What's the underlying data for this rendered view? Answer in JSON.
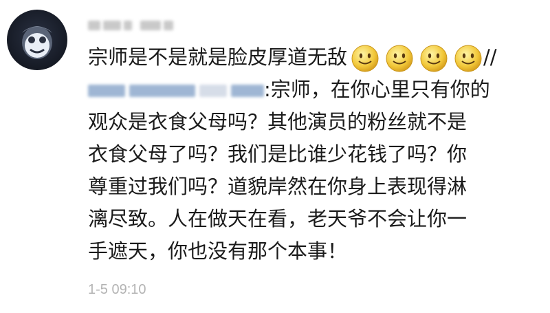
{
  "comment": {
    "line1": "宗师是不是就是脸皮厚道无敌",
    "separator": "//",
    "reply_prefix": ":宗师，在你心里只有你的",
    "lines": [
      "观众是衣食父母吗？其他演员的粉丝就不是",
      "衣食父母了吗？我们是比谁少花钱了吗？你",
      "尊重过我们吗？道貌岸然在你身上表现得淋",
      "漓尽致。人在做天在看，老天爷不会让你一",
      "手遮天，你也没有那个本事！"
    ],
    "emoji_icons": [
      "smile-emoji-icon",
      "smile-emoji-icon",
      "smile-emoji-icon",
      "smile-emoji-icon"
    ],
    "timestamp": "1-5 09:10"
  }
}
